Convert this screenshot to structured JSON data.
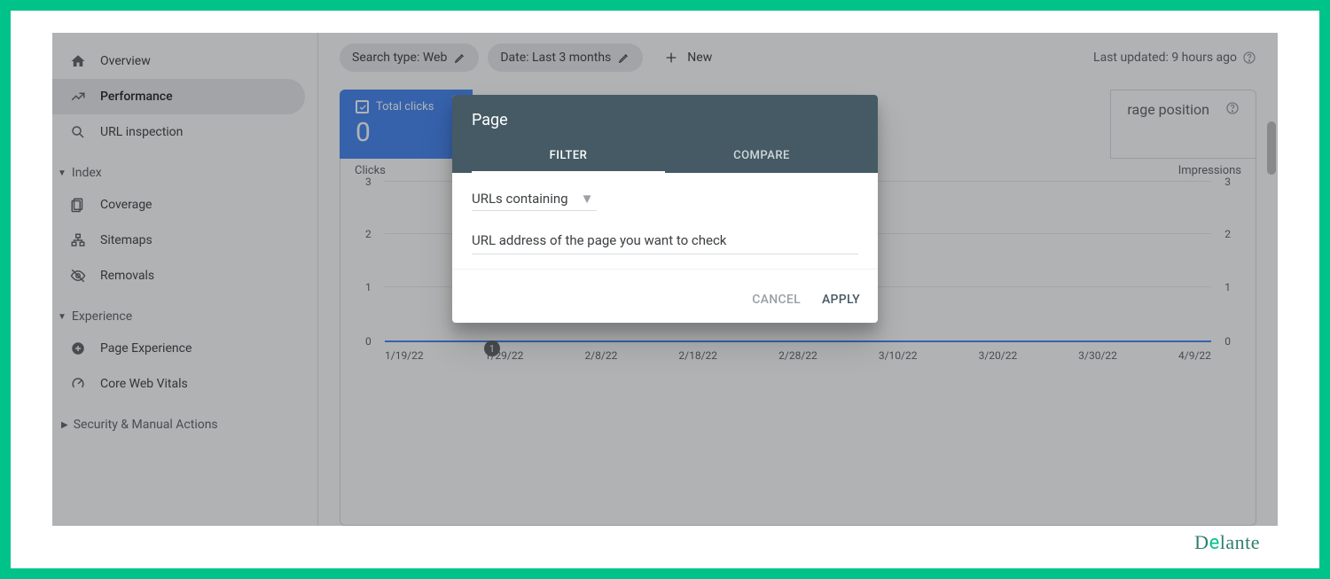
{
  "sidebar": {
    "overview": "Overview",
    "performance": "Performance",
    "url_inspection": "URL inspection",
    "index": "Index",
    "coverage": "Coverage",
    "sitemaps": "Sitemaps",
    "removals": "Removals",
    "experience": "Experience",
    "page_experience": "Page Experience",
    "core_web_vitals": "Core Web Vitals",
    "security": "Security & Manual Actions"
  },
  "chips": {
    "search_type": "Search type: Web",
    "date": "Date: Last 3 months",
    "new": "New"
  },
  "updated": "Last updated: 9 hours ago",
  "metrics": {
    "total_clicks_label": "Total clicks",
    "total_clicks_value": "0",
    "avg_position": "rage position"
  },
  "chart": {
    "clicks_label": "Clicks",
    "impressions_label": "Impressions"
  },
  "chart_data": {
    "type": "line",
    "series": [
      {
        "name": "Clicks",
        "values": [
          0,
          0,
          0,
          0,
          0,
          0,
          0,
          0,
          0
        ]
      },
      {
        "name": "Impressions",
        "values": [
          0,
          0,
          0,
          0,
          0,
          0,
          0,
          0,
          0
        ]
      }
    ],
    "categories": [
      "1/19/22",
      "1/29/22",
      "2/8/22",
      "2/18/22",
      "2/28/22",
      "3/10/22",
      "3/20/22",
      "3/30/22",
      "4/9/22"
    ],
    "ylim_left": [
      0,
      3
    ],
    "y_ticks_left": [
      0,
      1,
      2,
      3
    ],
    "ylim_right": [
      0,
      3
    ],
    "y_ticks_right": [
      0,
      1,
      2,
      3
    ],
    "xlabel": "",
    "ylabel_left": "Clicks",
    "ylabel_right": "Impressions",
    "annotation": {
      "index": 1,
      "label": "1"
    }
  },
  "modal": {
    "title": "Page",
    "tab_filter": "FILTER",
    "tab_compare": "COMPARE",
    "select_label": "URLs containing",
    "input_value": "URL address of the page you want to check",
    "cancel": "CANCEL",
    "apply": "APPLY"
  },
  "brand": "Delante"
}
